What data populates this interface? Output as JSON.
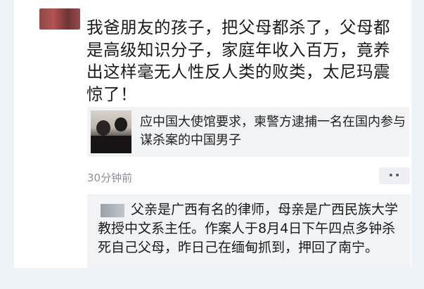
{
  "post": {
    "text": "我爸朋友的孩子，把父母都杀了，父母都是高级知识分子，家庭年收入百万，竟养出这样毫无人性反人类的败类，太尼玛震惊了！",
    "shared_article": {
      "title": "应中国大使馆要求，柬警方逮捕一名在国内参与谋杀案的中国男子"
    },
    "timestamp": "30分钟前",
    "more_label": "••"
  },
  "comment": {
    "text": "父亲是广西有名的律师，母亲是广西民族大学教授中文系主任。作案人于8月4日下午四点多钟杀死自己父母，昨日己在缅甸抓到，押回了南宁。"
  },
  "colors": {
    "background": "#eef3f8",
    "card": "#ffffff",
    "quote_bg": "#f2f3f5",
    "timestamp": "#8a8f99",
    "link": "#4a5a78"
  }
}
